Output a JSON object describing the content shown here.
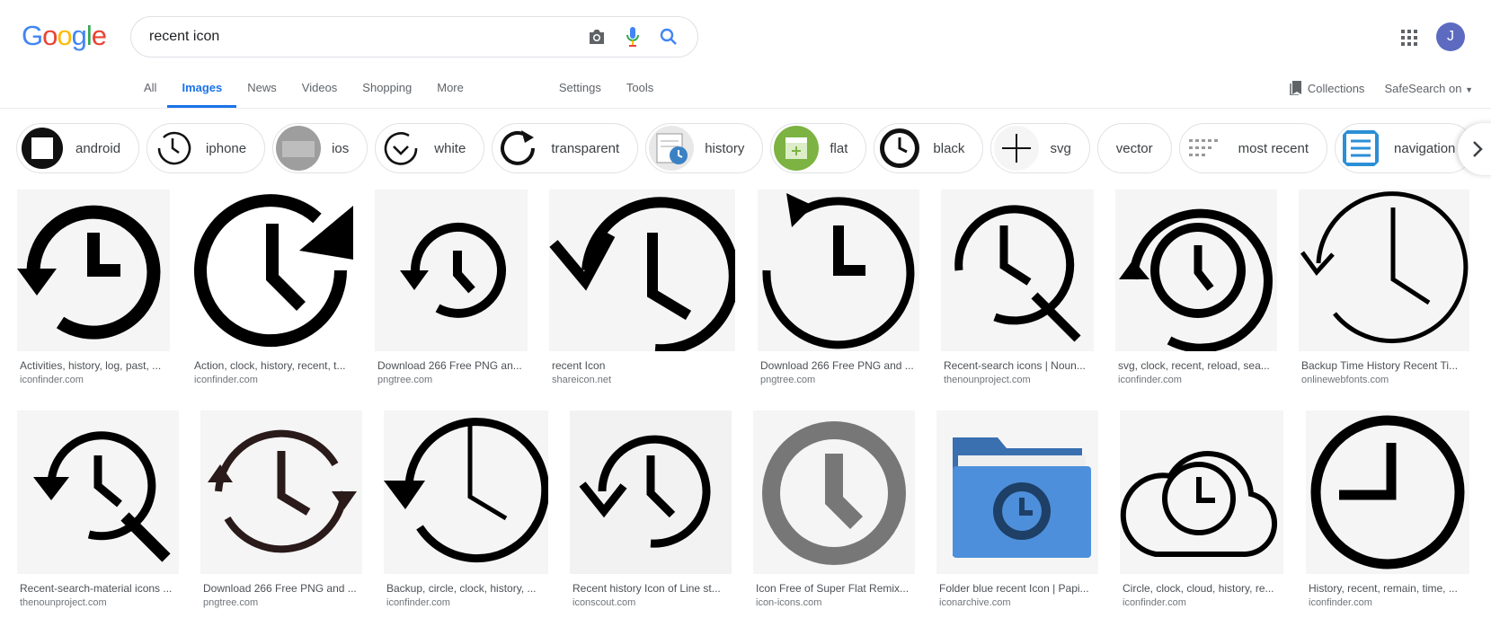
{
  "header": {
    "logo_letters": [
      "G",
      "o",
      "o",
      "g",
      "l",
      "e"
    ],
    "search_query": "recent icon",
    "avatar_initial": "J"
  },
  "tabs": [
    {
      "label": "All"
    },
    {
      "label": "Images"
    },
    {
      "label": "News"
    },
    {
      "label": "Videos"
    },
    {
      "label": "Shopping"
    },
    {
      "label": "More"
    },
    {
      "label": "Settings"
    },
    {
      "label": "Tools"
    }
  ],
  "tools": {
    "collections": "Collections",
    "safesearch": "SafeSearch on"
  },
  "chips": [
    {
      "label": "android"
    },
    {
      "label": "iphone"
    },
    {
      "label": "ios"
    },
    {
      "label": "white"
    },
    {
      "label": "transparent"
    },
    {
      "label": "history"
    },
    {
      "label": "flat"
    },
    {
      "label": "black"
    },
    {
      "label": "svg"
    },
    {
      "label": "vector"
    },
    {
      "label": "most recent"
    },
    {
      "label": "navigation"
    }
  ],
  "results": [
    {
      "title": "Activities, history, log, past, ...",
      "source": "iconfinder.com"
    },
    {
      "title": "Action, clock, history, recent, t...",
      "source": "iconfinder.com"
    },
    {
      "title": "Download 266 Free PNG an...",
      "source": "pngtree.com"
    },
    {
      "title": "recent Icon",
      "source": "shareicon.net"
    },
    {
      "title": "Download 266 Free PNG and ...",
      "source": "pngtree.com"
    },
    {
      "title": "Recent-search icons | Noun...",
      "source": "thenounproject.com"
    },
    {
      "title": "svg, clock, recent, reload, sea...",
      "source": "iconfinder.com"
    },
    {
      "title": "Backup Time History Recent Ti...",
      "source": "onlinewebfonts.com"
    },
    {
      "title": "Recent-search-material icons ...",
      "source": "thenounproject.com"
    },
    {
      "title": "Download 266 Free PNG and ...",
      "source": "pngtree.com"
    },
    {
      "title": "Backup, circle, clock, history, ...",
      "source": "iconfinder.com"
    },
    {
      "title": "Recent history Icon of Line st...",
      "source": "iconscout.com"
    },
    {
      "title": "Icon Free of Super Flat Remix...",
      "source": "icon-icons.com"
    },
    {
      "title": "Folder blue recent Icon | Papi...",
      "source": "iconarchive.com"
    },
    {
      "title": "Circle, clock, cloud, history, re...",
      "source": "iconfinder.com"
    },
    {
      "title": "History, recent, remain, time, ...",
      "source": "iconfinder.com"
    }
  ]
}
